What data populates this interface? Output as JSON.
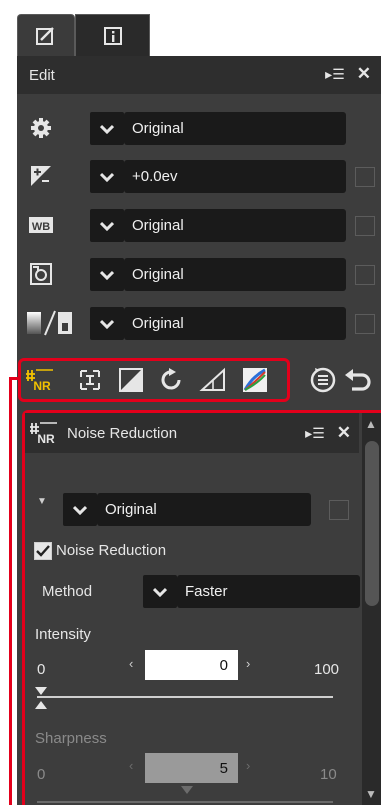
{
  "colors": {
    "panel_bg": "#3d3d3d",
    "header_bg": "#2e2e2e",
    "field_bg": "#1a1a1a",
    "highlight_red": "#e3001b",
    "nr_icon_yellow": "#f2c200"
  },
  "tabs": [
    {
      "icon": "edit-tab-icon"
    },
    {
      "icon": "info-tab-icon"
    }
  ],
  "edit": {
    "title": "Edit",
    "rows": [
      {
        "icon": "gear-icon",
        "value": "Original"
      },
      {
        "icon": "exposure-icon",
        "value": "+0.0ev"
      },
      {
        "icon": "white-balance-icon",
        "value": "Original"
      },
      {
        "icon": "picture-control-icon",
        "value": "Original"
      },
      {
        "icon": "tone-icon",
        "value": "Original"
      }
    ]
  },
  "tools": {
    "highlighted": [
      "noise-reduction-tool-icon",
      "straighten-tool-icon",
      "levels-tool-icon",
      "rotate-tool-icon",
      "perspective-tool-icon",
      "color-tool-icon"
    ],
    "extra": [
      "adjustment-manager-icon",
      "undo-icon"
    ]
  },
  "nr": {
    "icon_text": "NR",
    "title": "Noise Reduction",
    "preset": "Original",
    "checkbox_label": "Noise Reduction",
    "method_label": "Method",
    "method_value": "Faster",
    "intensity": {
      "label": "Intensity",
      "min": "0",
      "max": "100",
      "value": "0"
    },
    "sharpness": {
      "label": "Sharpness",
      "min": "0",
      "max": "10",
      "value": "5"
    }
  },
  "symbols": {
    "menu": "▸☰",
    "close": "✕",
    "left": "‹",
    "right": "›",
    "triangle_down": "▼",
    "chevron_down": "✔",
    "check": "✔",
    "up": "▲",
    "down": "▼"
  }
}
